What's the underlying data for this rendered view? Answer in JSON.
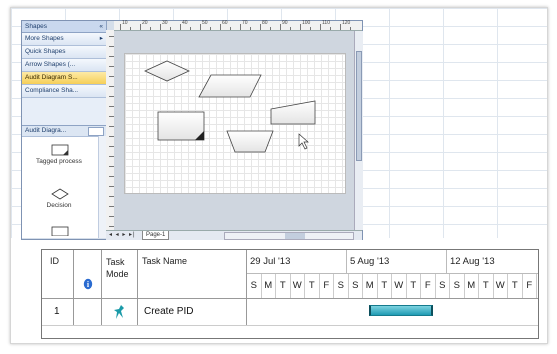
{
  "shapes_panel": {
    "title": "Shapes",
    "close_glyph": "«",
    "items": [
      {
        "label": "More Shapes",
        "arrow": "▸",
        "active": false
      },
      {
        "label": "Quick Shapes",
        "arrow": "",
        "active": false
      },
      {
        "label": "Arrow Shapes (...",
        "arrow": "",
        "active": false
      },
      {
        "label": "Audit Diagram S...",
        "arrow": "",
        "active": true
      },
      {
        "label": "Compliance Sha...",
        "arrow": "",
        "active": false
      }
    ],
    "stencil_title": "Audit Diagra...",
    "stencil_shapes": [
      {
        "label": "Tagged process"
      },
      {
        "label": "Decision"
      }
    ]
  },
  "ruler": {
    "labels": [
      "10",
      "20",
      "30",
      "40",
      "50",
      "60",
      "70",
      "80",
      "90",
      "100",
      "110",
      "120"
    ]
  },
  "statusbar": {
    "nav": "◂ ◂ ▸ ▸|",
    "page_tab": "Page-1"
  },
  "project": {
    "columns": {
      "id": "ID",
      "info_icon": "i",
      "task_mode": "Task Mode",
      "task_name": "Task Name"
    },
    "weeks": [
      "29 Jul '13",
      "5 Aug '13",
      "12 Aug '13"
    ],
    "days": [
      "S",
      "M",
      "T",
      "W",
      "T",
      "F",
      "S",
      "S",
      "M",
      "T",
      "W",
      "T",
      "F",
      "S",
      "S",
      "M",
      "T",
      "W",
      "T",
      "F"
    ],
    "rows": [
      {
        "id": "1",
        "mode_icon": "auto-schedule-icon",
        "name": "Create PID"
      }
    ]
  },
  "colors": {
    "active_item": "#f6cf58",
    "gantt_bar": "#1f9bb3"
  }
}
